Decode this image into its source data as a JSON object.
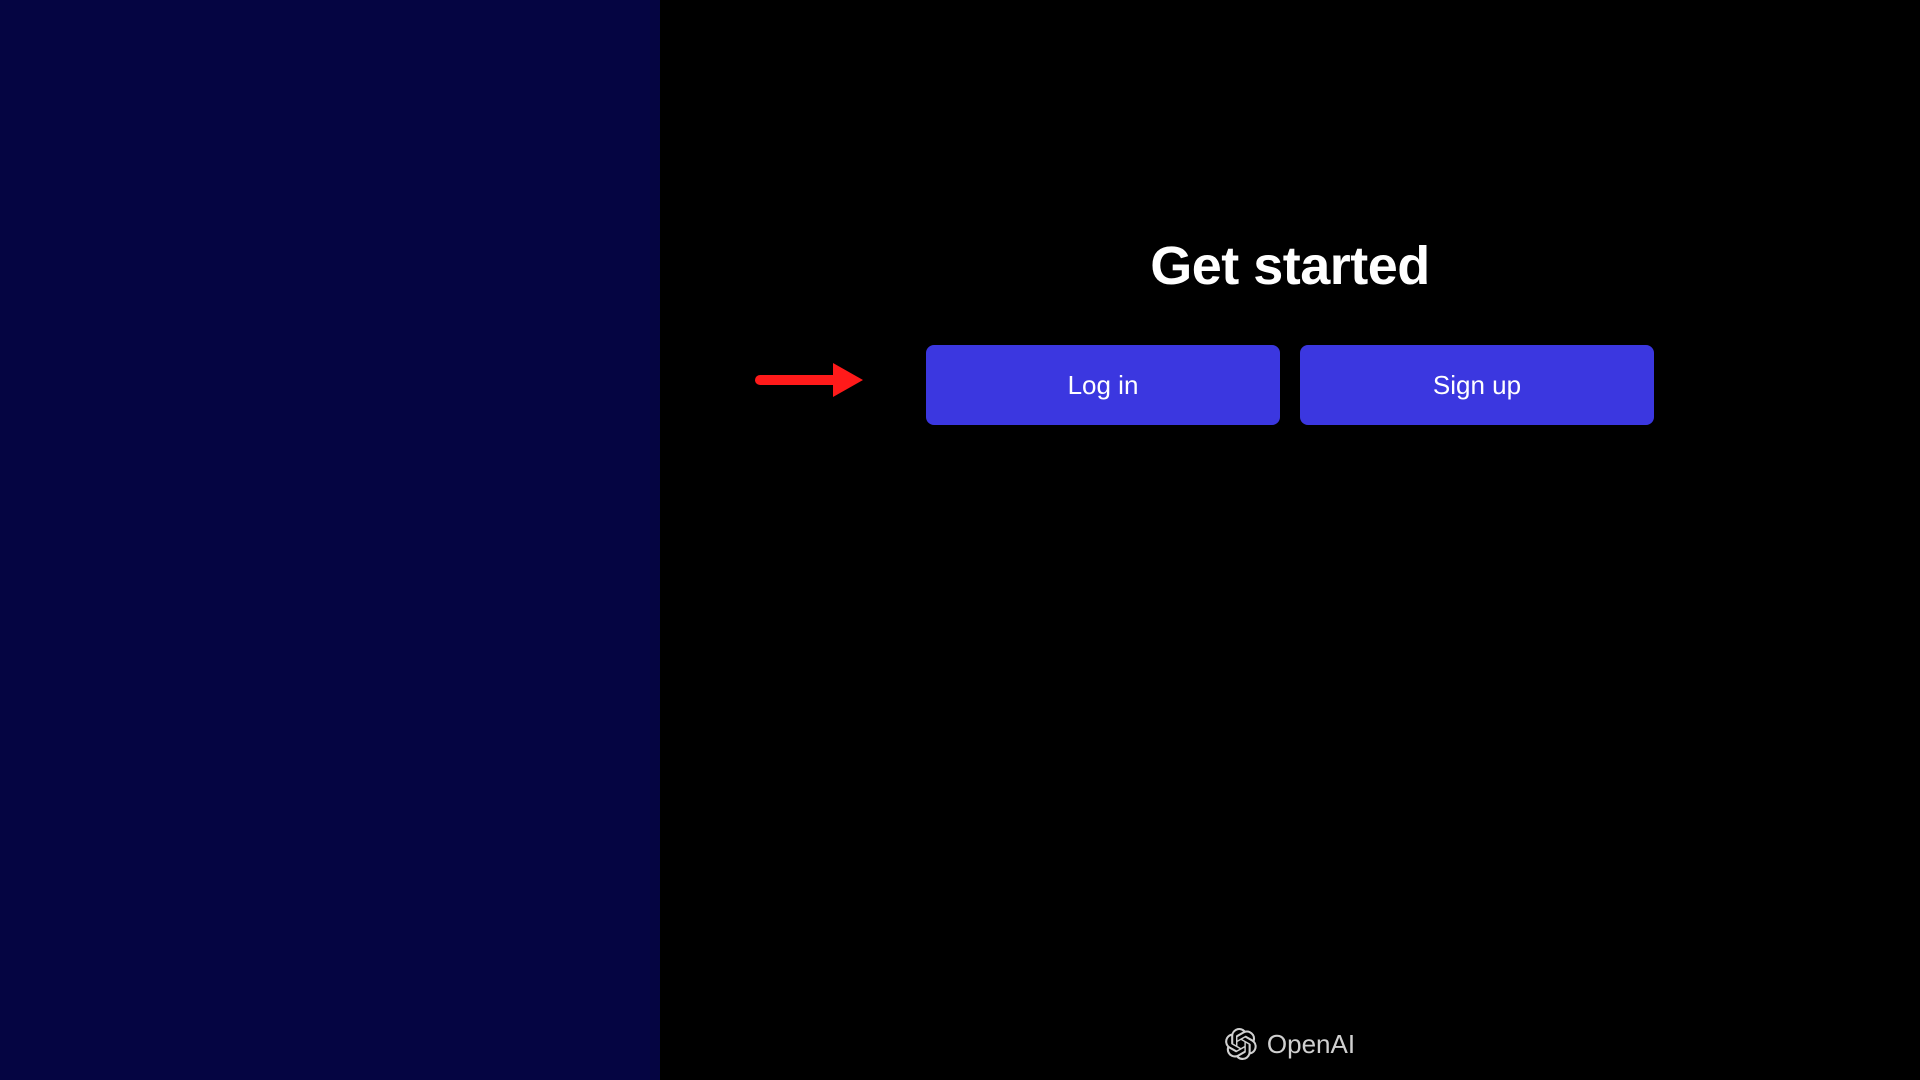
{
  "heading": "Get started",
  "buttons": {
    "login": "Log in",
    "signup": "Sign up"
  },
  "footer": {
    "brand": "OpenAI"
  },
  "colors": {
    "accent": "#3b37e0",
    "left_panel": "#050542",
    "right_panel": "#000000",
    "annotation": "#ff1a1a"
  }
}
